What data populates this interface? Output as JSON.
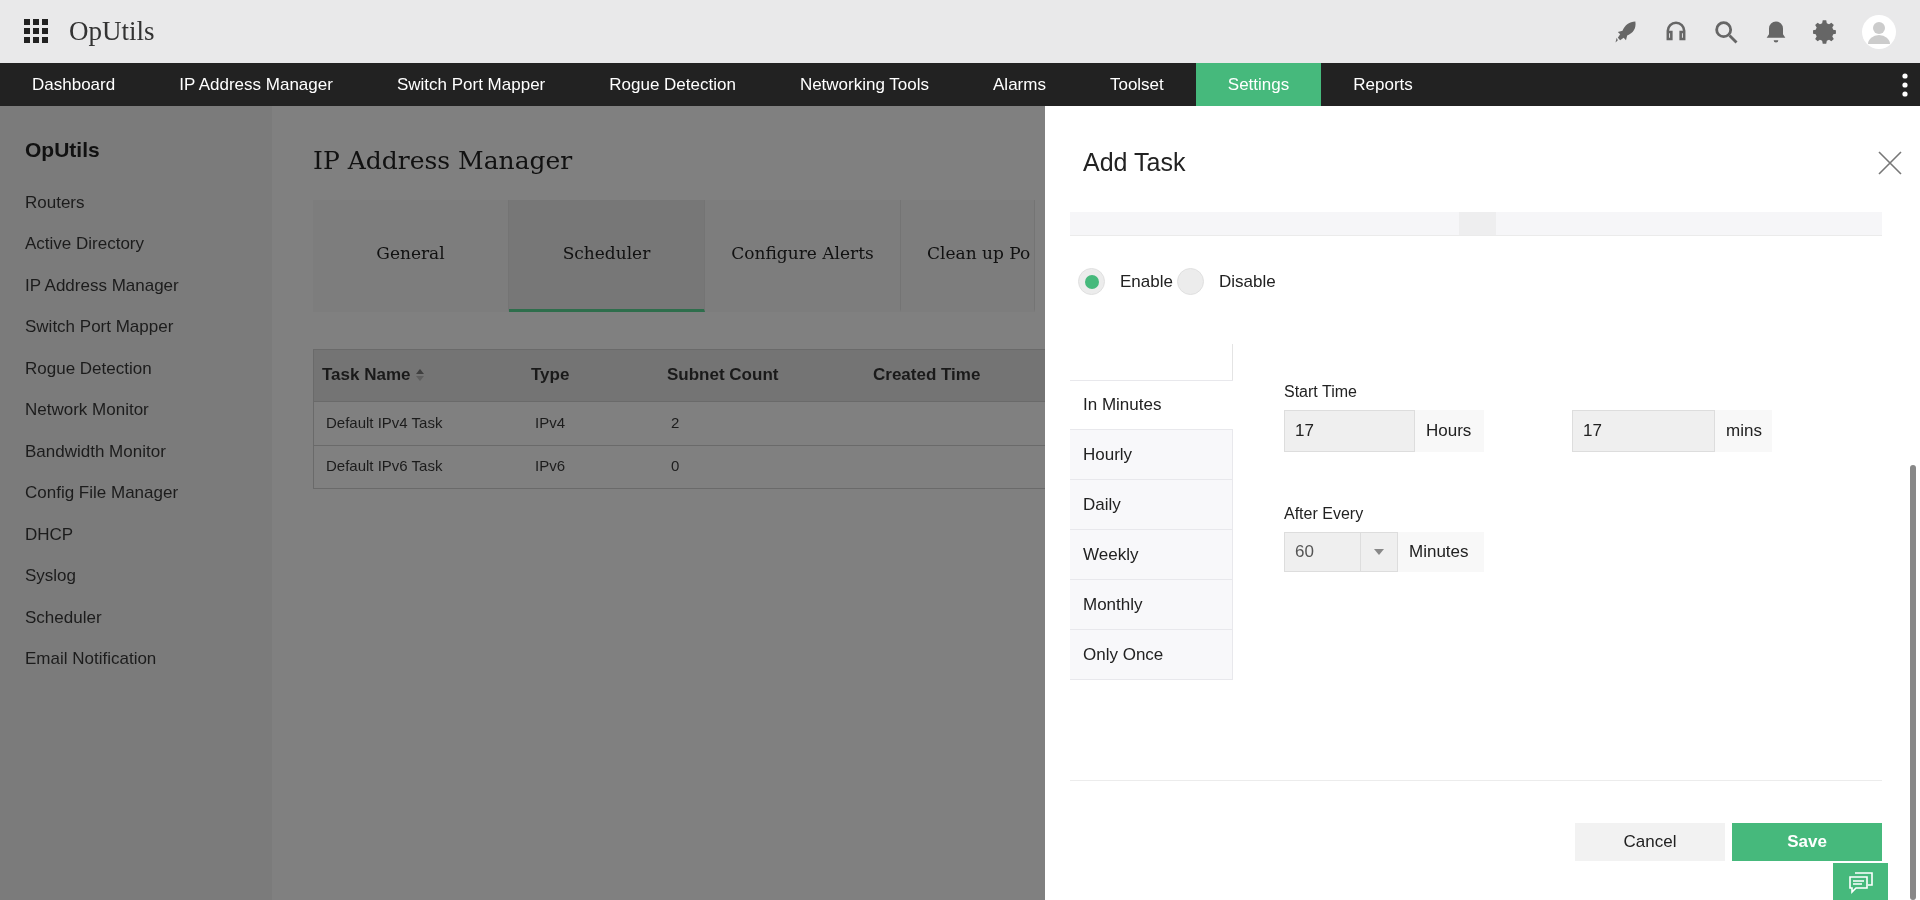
{
  "header": {
    "app_title": "OpUtils"
  },
  "nav": [
    {
      "label": "Dashboard",
      "selected": false
    },
    {
      "label": "IP Address Manager",
      "selected": false
    },
    {
      "label": "Switch Port Mapper",
      "selected": false
    },
    {
      "label": "Rogue Detection",
      "selected": false
    },
    {
      "label": "Networking Tools",
      "selected": false
    },
    {
      "label": "Alarms",
      "selected": false
    },
    {
      "label": "Toolset",
      "selected": false
    },
    {
      "label": "Settings",
      "selected": true
    },
    {
      "label": "Reports",
      "selected": false
    }
  ],
  "sidebar": {
    "title": "OpUtils",
    "items": [
      "Routers",
      "Active Directory",
      "IP Address Manager",
      "Switch Port Mapper",
      "Rogue Detection",
      "Network Monitor",
      "Bandwidth Monitor",
      "Config File Manager",
      "DHCP",
      "Syslog",
      "Scheduler",
      "Email Notification"
    ]
  },
  "page": {
    "title": "IP Address Manager",
    "tabs": [
      {
        "label": "General",
        "selected": false
      },
      {
        "label": "Scheduler",
        "selected": true
      },
      {
        "label": "Configure Alerts",
        "selected": false
      },
      {
        "label": "Clean up Po",
        "selected": false
      }
    ],
    "table": {
      "columns": [
        {
          "label": "Task Name",
          "sorted": true
        },
        {
          "label": "Type",
          "sorted": false
        },
        {
          "label": "Subnet Count",
          "sorted": false
        },
        {
          "label": "Created Time",
          "sorted": false
        }
      ],
      "rows": [
        [
          "Default IPv4 Task",
          "IPv4",
          "2"
        ],
        [
          "Default IPv6 Task",
          "IPv6",
          "0"
        ]
      ]
    }
  },
  "dialog": {
    "title": "Add Task",
    "status_options": [
      {
        "label": "Enable",
        "selected": true
      },
      {
        "label": "Disable",
        "selected": false
      }
    ],
    "schedule_tabs": [
      {
        "label": "In Minutes",
        "selected": true
      },
      {
        "label": "Hourly",
        "selected": false
      },
      {
        "label": "Daily",
        "selected": false
      },
      {
        "label": "Weekly",
        "selected": false
      },
      {
        "label": "Monthly",
        "selected": false
      },
      {
        "label": "Only Once",
        "selected": false
      }
    ],
    "start_time": {
      "label": "Start Time",
      "hours_value": "17",
      "hours_unit": "Hours",
      "mins_value": "17",
      "mins_unit": "mins"
    },
    "after_every": {
      "label": "After Every",
      "value": "60",
      "unit": "Minutes"
    },
    "buttons": {
      "cancel": "Cancel",
      "save": "Save"
    }
  }
}
